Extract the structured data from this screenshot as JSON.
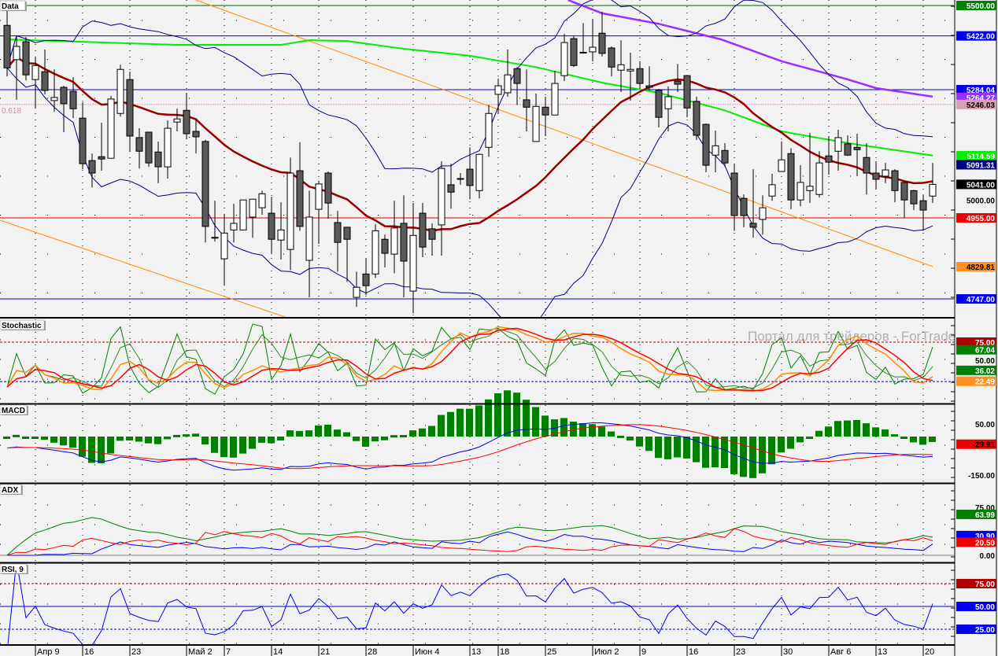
{
  "panels": {
    "main_title": "Data",
    "stochastic_title": "Stochastic",
    "macd_title": "MACD",
    "adx_title": "ADX",
    "rsi_title": "RSI, 9"
  },
  "watermark": "Портал для трейдеров - ForTrader.ru",
  "fib_label": "0.618",
  "chart_data": {
    "type": "candlestick",
    "ohlc_format": [
      "open",
      "high",
      "low",
      "close"
    ],
    "candles": [
      [
        5449,
        5490,
        5318,
        5340
      ],
      [
        5361,
        5423,
        5258,
        5395
      ],
      [
        5407,
        5419,
        5308,
        5322
      ],
      [
        5310,
        5369,
        5235,
        5346
      ],
      [
        5330,
        5387,
        5272,
        5282
      ],
      [
        5256,
        5336,
        5227,
        5264
      ],
      [
        5290,
        5294,
        5175,
        5248
      ],
      [
        5280,
        5316,
        5211,
        5235
      ],
      [
        5211,
        5252,
        5080,
        5094
      ],
      [
        5102,
        5120,
        5033,
        5070
      ],
      [
        5112,
        5199,
        5076,
        5106
      ],
      [
        5108,
        5268,
        5108,
        5260
      ],
      [
        5223,
        5348,
        5215,
        5336
      ],
      [
        5310,
        5330,
        5126,
        5165
      ],
      [
        5161,
        5185,
        5082,
        5126
      ],
      [
        5175,
        5175,
        5086,
        5096
      ],
      [
        5124,
        5151,
        5044,
        5086
      ],
      [
        5086,
        5205,
        5056,
        5185
      ],
      [
        5201,
        5235,
        5177,
        5209
      ],
      [
        5231,
        5276,
        5157,
        5171
      ],
      [
        5177,
        5211,
        5120,
        5163
      ],
      [
        5151,
        5155,
        4892,
        4933
      ],
      [
        4905,
        4999,
        4894,
        4904
      ],
      [
        4850,
        4963,
        4781,
        4916
      ],
      [
        4924,
        4991,
        4892,
        4941
      ],
      [
        4924,
        5001,
        4924,
        5001
      ],
      [
        4957,
        5003,
        4904,
        5003
      ],
      [
        4981,
        5025,
        4963,
        5017
      ],
      [
        4967,
        5009,
        4862,
        4900
      ],
      [
        4898,
        4995,
        4848,
        4924
      ],
      [
        4874,
        5110,
        4821,
        5070
      ],
      [
        5076,
        5149,
        4922,
        4933
      ],
      [
        4846,
        5025,
        4751,
        4957
      ],
      [
        4977,
        5050,
        4888,
        5042
      ],
      [
        5070,
        5074,
        4953,
        4993
      ],
      [
        4943,
        4973,
        4817,
        4892
      ],
      [
        4931,
        4931,
        4791,
        4900
      ],
      [
        4751,
        4817,
        4727,
        4777
      ],
      [
        4811,
        4850,
        4757,
        4781
      ],
      [
        4811,
        4939,
        4801,
        4922
      ],
      [
        4900,
        4912,
        4828,
        4864
      ],
      [
        4862,
        4999,
        4813,
        4929
      ],
      [
        4941,
        5013,
        4751,
        4844
      ],
      [
        4767,
        4993,
        4710,
        4910
      ],
      [
        4967,
        4993,
        4854,
        4880
      ],
      [
        4927,
        4941,
        4858,
        4900
      ],
      [
        4937,
        5100,
        4858,
        5082
      ],
      [
        5040,
        5094,
        4979,
        5021
      ],
      [
        5056,
        5070,
        5040,
        5055
      ],
      [
        5080,
        5136,
        5003,
        5038
      ],
      [
        5025,
        5120,
        5005,
        5118
      ],
      [
        5136,
        5245,
        5112,
        5223
      ],
      [
        5272,
        5312,
        5223,
        5294
      ],
      [
        5276,
        5387,
        5266,
        5322
      ],
      [
        5338,
        5342,
        5245,
        5300
      ],
      [
        5258,
        5336,
        5177,
        5239
      ],
      [
        5151,
        5274,
        5151,
        5241
      ],
      [
        5239,
        5266,
        5165,
        5219
      ],
      [
        5219,
        5332,
        5219,
        5300
      ],
      [
        5320,
        5427,
        5306,
        5405
      ],
      [
        5415,
        5421,
        5342,
        5346
      ],
      [
        5380,
        5455,
        5377,
        5379
      ],
      [
        5381,
        5464,
        5357,
        5393
      ],
      [
        5429,
        5484,
        5369,
        5377
      ],
      [
        5391,
        5395,
        5318,
        5342
      ],
      [
        5334,
        5411,
        5278,
        5348
      ],
      [
        5332,
        5379,
        5256,
        5336
      ],
      [
        5338,
        5357,
        5286,
        5300
      ],
      [
        5294,
        5344,
        5282,
        5290
      ],
      [
        5282,
        5286,
        5187,
        5213
      ],
      [
        5235,
        5292,
        5177,
        5266
      ],
      [
        5306,
        5350,
        5278,
        5298
      ],
      [
        5320,
        5322,
        5213,
        5237
      ],
      [
        5254,
        5266,
        5155,
        5167
      ],
      [
        5195,
        5197,
        5072,
        5090
      ],
      [
        5116,
        5179,
        5072,
        5140
      ],
      [
        5128,
        5147,
        5086,
        5096
      ],
      [
        5070,
        5094,
        4922,
        4961
      ],
      [
        5005,
        5015,
        4931,
        4961
      ],
      [
        4941,
        5080,
        4904,
        4931
      ],
      [
        4951,
        5013,
        4912,
        4981
      ],
      [
        5011,
        5068,
        4999,
        5040
      ],
      [
        5074,
        5151,
        5074,
        5104
      ],
      [
        5120,
        5134,
        4977,
        5001
      ],
      [
        5001,
        5090,
        4985,
        5046
      ],
      [
        5025,
        5173,
        4993,
        5036
      ],
      [
        5015,
        5126,
        5007,
        5096
      ],
      [
        5114,
        5165,
        5066,
        5098
      ],
      [
        5126,
        5181,
        5076,
        5161
      ],
      [
        5145,
        5167,
        5114,
        5116
      ],
      [
        5136,
        5171,
        5062,
        5130
      ],
      [
        5110,
        5147,
        5015,
        5070
      ],
      [
        5070,
        5100,
        5029,
        5054
      ],
      [
        5062,
        5096,
        5044,
        5078
      ],
      [
        5076,
        5080,
        4995,
        5025
      ],
      [
        5046,
        5046,
        4955,
        5001
      ],
      [
        5025,
        5027,
        4975,
        4991
      ],
      [
        4999,
        5015,
        4922,
        4975
      ],
      [
        5011,
        5096,
        4993,
        5041
      ]
    ],
    "x_labels": [
      {
        "index": 3,
        "text": "Апр 9"
      },
      {
        "index": 8,
        "text": "16"
      },
      {
        "index": 13,
        "text": "23"
      },
      {
        "index": 19,
        "text": "Май 2"
      },
      {
        "index": 23,
        "text": "7"
      },
      {
        "index": 28,
        "text": "14"
      },
      {
        "index": 33,
        "text": "21"
      },
      {
        "index": 38,
        "text": "28"
      },
      {
        "index": 43,
        "text": "Июн 4"
      },
      {
        "index": 49,
        "text": "13"
      },
      {
        "index": 52,
        "text": "18"
      },
      {
        "index": 57,
        "text": "25"
      },
      {
        "index": 62,
        "text": "Июл 2"
      },
      {
        "index": 67,
        "text": "9"
      },
      {
        "index": 72,
        "text": "16"
      },
      {
        "index": 77,
        "text": "23"
      },
      {
        "index": 82,
        "text": "30"
      },
      {
        "index": 87,
        "text": "Авг 6"
      },
      {
        "index": 92,
        "text": "13"
      },
      {
        "index": 97,
        "text": "20"
      }
    ],
    "y_range": [
      4700,
      5500
    ],
    "overlays": {
      "sma_long_green": [
        [
          0,
          5413
        ],
        [
          18,
          5399
        ],
        [
          29,
          5399
        ],
        [
          32,
          5411
        ],
        [
          36,
          5409
        ],
        [
          42,
          5389
        ],
        [
          49,
          5371
        ],
        [
          56,
          5342
        ],
        [
          63,
          5302
        ],
        [
          69,
          5276
        ],
        [
          76,
          5231
        ],
        [
          82,
          5177
        ],
        [
          89,
          5147
        ],
        [
          98,
          5115
        ]
      ],
      "sma_longest_purple": [
        [
          59.4,
          5514
        ],
        [
          63,
          5480
        ],
        [
          69,
          5453
        ],
        [
          75.6,
          5413
        ],
        [
          82,
          5357
        ],
        [
          88.75,
          5312
        ],
        [
          92,
          5288
        ],
        [
          98,
          5266
        ]
      ],
      "trendline_upper": [
        [
          20,
          5514
        ],
        [
          98,
          4830
        ]
      ],
      "trendline_lower": [
        [
          -0.75,
          4949
        ],
        [
          30,
          4696
        ]
      ],
      "ma_period": 20,
      "bollinger_period": 20,
      "bollinger_dev": 2
    },
    "levels": [
      {
        "price": 5500,
        "color": "#006400",
        "dash": false
      },
      {
        "price": 5422,
        "color": "#0000cc",
        "dash": false
      },
      {
        "price": 5284.04,
        "color": "#0000cc",
        "dash": false
      },
      {
        "price": 5246.03,
        "color": "#d8a0b0",
        "dash": true
      },
      {
        "price": 4955,
        "color": "#e00000",
        "dash": false
      },
      {
        "price": 4747,
        "color": "#0000cc",
        "dash": false
      }
    ],
    "indicator_levels": {
      "stochastic": [
        {
          "value": 75,
          "color": "#aa0000"
        },
        {
          "value": 20.5,
          "color": "#0000cc"
        }
      ],
      "rsi": [
        {
          "value": 75,
          "color": "#aa0000",
          "dash": true
        },
        {
          "value": 50,
          "color": "#0000cc",
          "dash": false
        },
        {
          "value": 25,
          "color": "#0000cc",
          "dash": true
        }
      ],
      "adx_zero": 0,
      "rsi_period": 9
    },
    "axis_labels": [
      {
        "panel": "main",
        "value": 5500,
        "text": "5500.00",
        "bg": "#008000",
        "fg": "#ffffff"
      },
      {
        "panel": "main",
        "value": 5422,
        "text": "5422.00",
        "bg": "#0000ee",
        "fg": "#ffffff"
      },
      {
        "panel": "main",
        "value": 5284.04,
        "text": "5284.04",
        "bg": "#0000ee",
        "fg": "#ffffff"
      },
      {
        "panel": "main",
        "value": 5264.27,
        "text": "5264.27",
        "bg": "#9a30ff",
        "fg": "#ffffff"
      },
      {
        "panel": "main",
        "value": 5246.03,
        "text": "5246.03",
        "bg": "#d8a0b0",
        "fg": "#000000"
      },
      {
        "panel": "main",
        "value": 5114.59,
        "text": "5114.59",
        "bg": "#00ee00",
        "fg": "#ffffff"
      },
      {
        "panel": "main",
        "value": 5091.31,
        "text": "5091.31",
        "bg": "#000080",
        "fg": "#ffffff"
      },
      {
        "panel": "main",
        "value": 5041,
        "text": "5041.00",
        "bg": "#000000",
        "fg": "#ffffff"
      },
      {
        "panel": "main",
        "value": 5000,
        "text": "5000.00",
        "bg": "",
        "fg": "#000000"
      },
      {
        "panel": "main",
        "value": 4955,
        "text": "4955.00",
        "bg": "#ee0000",
        "fg": "#ffffff"
      },
      {
        "panel": "main",
        "value": 4829.81,
        "text": "4829.81",
        "bg": "#ff9020",
        "fg": "#000000"
      },
      {
        "panel": "main",
        "value": 4747,
        "text": "4747.00",
        "bg": "#0000ee",
        "fg": "#ffffff"
      },
      {
        "panel": "stoch",
        "value": 75,
        "text": "75.00",
        "bg": "#b00000",
        "fg": "#ffffff"
      },
      {
        "panel": "stoch",
        "value": 64.5,
        "text": "67.04",
        "bg": "#008000",
        "fg": "#ffffff"
      },
      {
        "panel": "stoch",
        "value": 50,
        "text": "50.00",
        "bg": "",
        "fg": "#000000"
      },
      {
        "panel": "stoch",
        "value": 36.02,
        "text": "36.02",
        "bg": "#008000",
        "fg": "#ffffff"
      },
      {
        "panel": "stoch",
        "value": 21,
        "text": "22.49",
        "bg": "#ff9020",
        "fg": "#ffffff"
      },
      {
        "panel": "macd",
        "value": 50,
        "text": "50.00",
        "bg": "",
        "fg": "#000000"
      },
      {
        "panel": "macd",
        "value": -29.91,
        "text": "-29.91",
        "bg": "#ee0000",
        "fg": "#000000"
      },
      {
        "panel": "macd",
        "value": -150,
        "text": "-150.00",
        "bg": "",
        "fg": "#000000"
      },
      {
        "panel": "adx",
        "value": 75,
        "text": "75.00",
        "bg": "",
        "fg": "#000000"
      },
      {
        "panel": "adx",
        "value": 63.99,
        "text": "63.99",
        "bg": "#008000",
        "fg": "#ffffff"
      },
      {
        "panel": "adx",
        "value": 30.9,
        "text": "30.90",
        "bg": "#0000ee",
        "fg": "#ffffff"
      },
      {
        "panel": "adx",
        "value": 20.5,
        "text": "20.50",
        "bg": "#ee0000",
        "fg": "#ffffff"
      },
      {
        "panel": "adx",
        "value": 0,
        "text": "0.00",
        "bg": "",
        "fg": "#000000"
      },
      {
        "panel": "rsi",
        "value": 75,
        "text": "75.00",
        "bg": "#b00000",
        "fg": "#ffffff"
      },
      {
        "panel": "rsi",
        "value": 50,
        "text": "50.00",
        "bg": "#0000ee",
        "fg": "#ffffff"
      },
      {
        "panel": "rsi",
        "value": 25,
        "text": "25.00",
        "bg": "#0000ee",
        "fg": "#ffffff"
      }
    ],
    "colors": {
      "bull_body": "#ffffff",
      "bear_body": "#5a5a5a",
      "ma20": "#990000",
      "bollinger": "#000080",
      "sma_green": "#00ee00",
      "sma_purple": "#9a30ff",
      "trend": "#ff8c00",
      "stoch_fast": "#008000",
      "stoch_fast_smooth": "#2e8b22",
      "stoch_slow": "#ff8c00",
      "stoch_signal": "#ff0000",
      "macd_hist": "#008000",
      "macd_line": "#0000ee",
      "macd_signal": "#ff0000",
      "adx": "#008000",
      "plus_di": "#0000ee",
      "minus_di": "#ff0000",
      "rsi": "#0000ee"
    }
  }
}
